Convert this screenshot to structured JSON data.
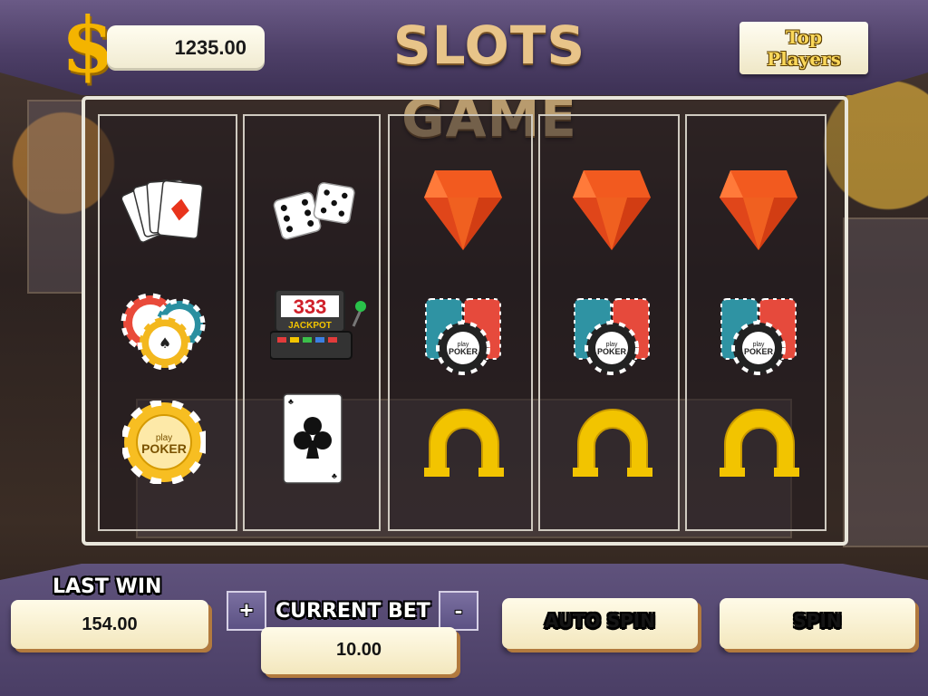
{
  "header": {
    "currency_symbol": "$",
    "balance": "1235.00",
    "title": "SLOTS GAME",
    "top_players_line1": "Top",
    "top_players_line2": "Players"
  },
  "reels": [
    [
      "cards-icon",
      "poker-chips-pile-icon",
      "yellow-poker-chip-icon"
    ],
    [
      "dice-icon",
      "jackpot-slot-machine-icon",
      "ace-of-clubs-card-icon"
    ],
    [
      "orange-diamond-icon",
      "chip-stacks-icon",
      "horseshoe-icon"
    ],
    [
      "orange-diamond-icon",
      "chip-stacks-icon",
      "horseshoe-icon"
    ],
    [
      "orange-diamond-icon",
      "chip-stacks-icon",
      "horseshoe-icon"
    ]
  ],
  "symbols": {
    "chip_text_small": "play",
    "chip_text_large": "POKER",
    "jackpot_digits": "333",
    "jackpot_label": "JACKPOT"
  },
  "footer": {
    "last_win_label": "LAST WIN",
    "last_win_value": "154.00",
    "increase_bet_label": "+",
    "current_bet_label": "CURRENT BET",
    "decrease_bet_label": "-",
    "current_bet_value": "10.00",
    "auto_spin_label": "AUTO SPIN",
    "spin_label": "SPIN"
  },
  "colors": {
    "frame_purple": "#5f527c",
    "title_gold": "#e8c489",
    "diamond_orange": "#f25a1f",
    "horseshoe_yellow": "#f2c400"
  }
}
